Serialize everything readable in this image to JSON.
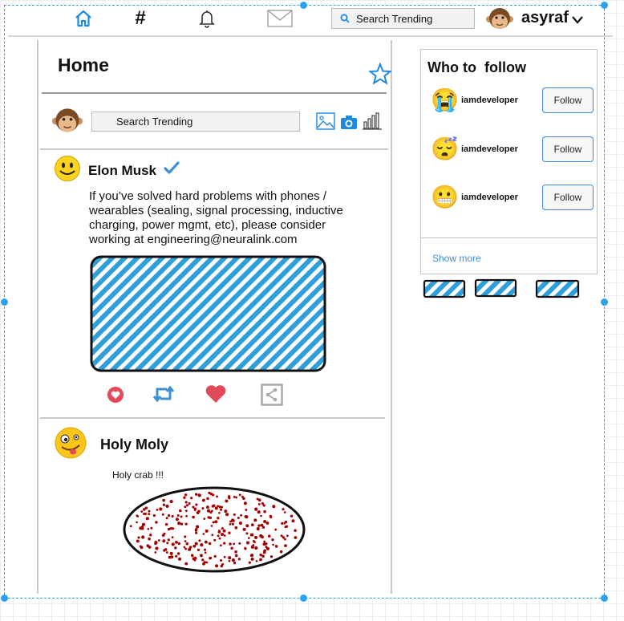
{
  "nav": {
    "items": [
      {
        "name": "home-icon"
      },
      {
        "name": "hashtag-icon",
        "glyph": "#"
      },
      {
        "name": "bell-icon"
      },
      {
        "name": "mail-icon"
      }
    ],
    "search_placeholder": "Search Trending",
    "username": "asyraf",
    "accent": "#1d8ae0"
  },
  "main": {
    "title": "Home",
    "compose": {
      "search_placeholder": "Search Trending"
    }
  },
  "posts": [
    {
      "author": "Elon Musk",
      "verified": true,
      "text_lines": [
        "If you’ve solved hard problems with phones /",
        "wearables (sealing, signal processing, inductive",
        "charging, power mgmt, etc), please consider",
        "working at engineering@neuralink.com"
      ]
    },
    {
      "author": "Holy Moly",
      "text": "Holy crab !!!"
    }
  ],
  "who_to_follow": {
    "title": "Who to  follow",
    "users": [
      {
        "name": "iamdeveloper",
        "button": "Follow",
        "emoji": "😭"
      },
      {
        "name": "iamdeveloper",
        "button": "Follow",
        "emoji": "😴"
      },
      {
        "name": "iamdeveloper",
        "button": "Follow",
        "emoji": "😬"
      }
    ],
    "show_more": "Show more"
  },
  "colors": {
    "hatch_blue": "#2f9fd8",
    "like_red": "#e14a5a",
    "retweet_blue": "#3d8fd6",
    "dots_red": "#a30000",
    "link_blue": "#3d8fd6"
  }
}
